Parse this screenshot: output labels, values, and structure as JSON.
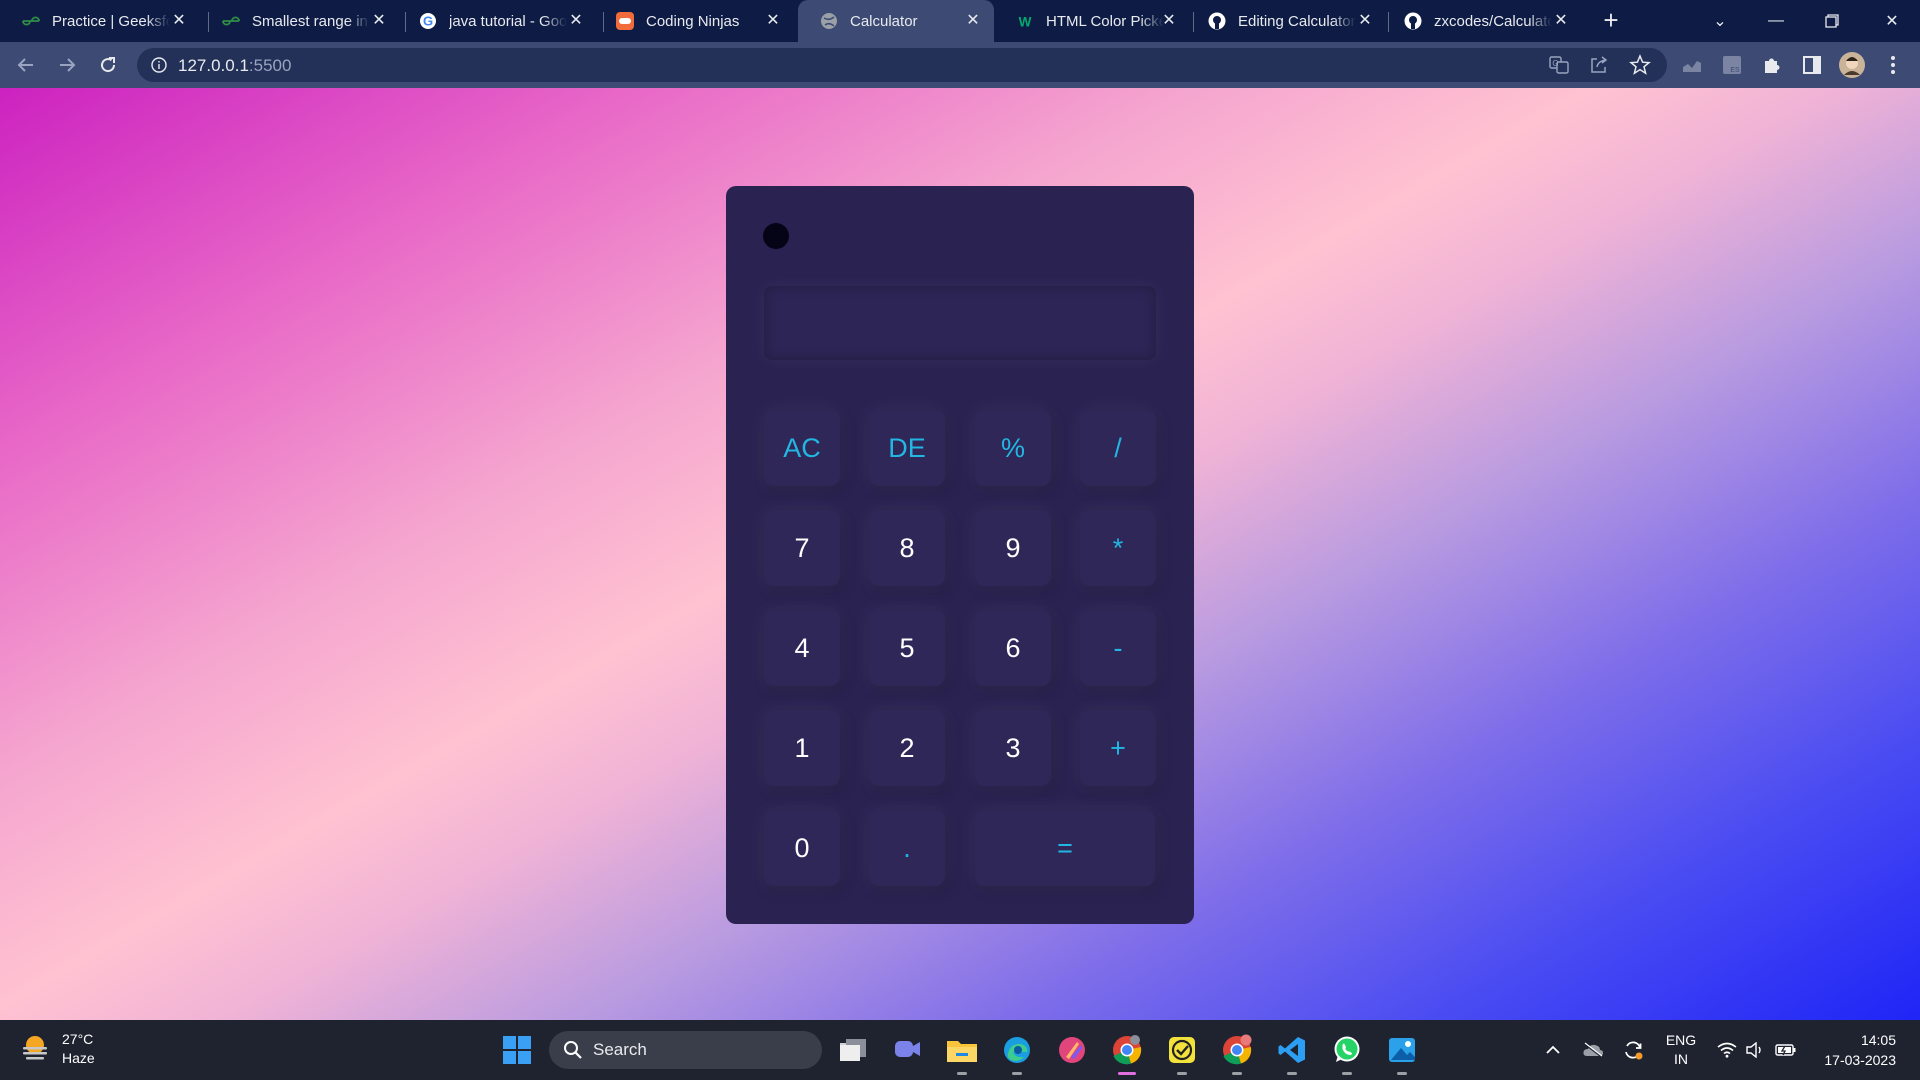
{
  "browser": {
    "tabs": [
      {
        "title": "Practice | GeeksforGeeks",
        "favicon": "gfg-icon"
      },
      {
        "title": "Smallest range in K lists",
        "favicon": "gfg-icon"
      },
      {
        "title": "java tutorial - Google Search",
        "favicon": "google-icon"
      },
      {
        "title": "Coding Ninjas",
        "favicon": "coding-ninjas-icon"
      },
      {
        "title": "Calculator",
        "favicon": "globe-icon",
        "active": true
      },
      {
        "title": "HTML Color Picker",
        "favicon": "w3schools-icon"
      },
      {
        "title": "Editing Calculator",
        "favicon": "github-icon"
      },
      {
        "title": "zxcodes/Calculator",
        "favicon": "github-icon"
      }
    ],
    "url": {
      "host": "127.0.0.1",
      "port": ":5500"
    }
  },
  "calculator": {
    "display": "",
    "keys": {
      "ac": "AC",
      "de": "DE",
      "percent": "%",
      "divide": "/",
      "seven": "7",
      "eight": "8",
      "nine": "9",
      "multiply": "*",
      "four": "4",
      "five": "5",
      "six": "6",
      "minus": "-",
      "one": "1",
      "two": "2",
      "three": "3",
      "plus": "+",
      "zero": "0",
      "dot": ".",
      "equals": "="
    },
    "colors": {
      "operator": "#22b7e2",
      "digit": "#ffffff",
      "body": "#2a2251"
    }
  },
  "taskbar": {
    "weather": {
      "temp": "27°C",
      "condition": "Haze"
    },
    "search_label": "Search",
    "lang": {
      "line1": "ENG",
      "line2": "IN"
    },
    "clock": {
      "time": "14:05",
      "date": "17-03-2023"
    }
  }
}
